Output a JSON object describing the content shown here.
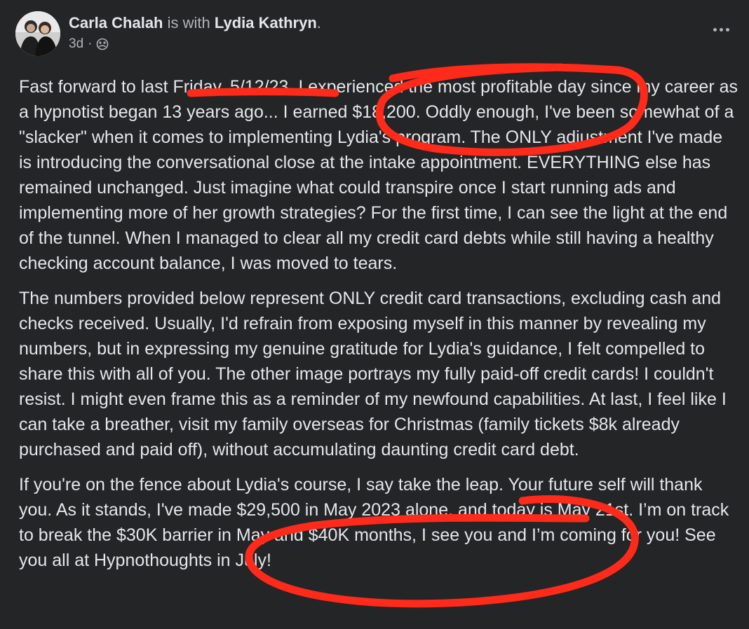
{
  "post": {
    "author": "Carla Chalah",
    "with_text": "is with",
    "tagged": "Lydia Kathryn",
    "period": ".",
    "time": "3d",
    "separator": "·",
    "audience_icon": "friends-globe-icon",
    "more_icon": "more-options-icon",
    "paragraphs": [
      "Fast forward to last Friday. 5/12/23. I experienced the most profitable day since my career as a hypnotist began 13 years ago... I earned $18,200. Oddly enough, I've been somewhat of a \"slacker\" when it comes to implementing Lydia's program. The ONLY adjustment I've made is introducing the conversational close at the intake appointment. EVERYTHING else has remained unchanged. Just imagine what could transpire once I start running ads and implementing more of her growth strategies? For the first time, I can see the light at the end of the tunnel. When I managed to clear all my credit card debts while still having a healthy checking account balance, I was moved to tears.",
      "The numbers provided below represent ONLY credit card transactions, excluding cash and checks received. Usually, I'd refrain from exposing myself in this manner by revealing my numbers, but in expressing my genuine gratitude for Lydia's guidance, I felt compelled to share this with all of you. The other image portrays my fully paid-off credit cards! I couldn't resist. I might even frame this as a reminder of my newfound capabilities. At last, I feel like I can take a breather, visit my family overseas for Christmas (family tickets $8k already purchased and paid off), without accumulating daunting credit card debt.",
      "If you're on the fence about Lydia's course, I say take the leap. Your future self will thank you. As it stands, I've made $29,500 in May 2023 alone, and today is May 21st. I’m on track to break the $30K barrier in May and $40K months, I see you and I’m coming for you! See you all at Hypnothoughts in July!"
    ]
  },
  "colors": {
    "background": "#242526",
    "primary_text": "#e4e6eb",
    "secondary_text": "#b0b3b8",
    "annotation": "#ff2a1a"
  }
}
